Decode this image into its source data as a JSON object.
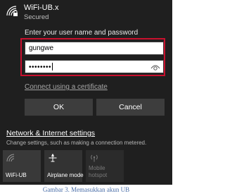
{
  "network": {
    "ssid": "WiFi-UB.x",
    "status": "Secured",
    "icon": "wifi-secured-icon"
  },
  "credentials": {
    "prompt": "Enter your user name and password",
    "username_value": "gungwe",
    "password_value": "••••••••",
    "reveal_icon": "eye-icon"
  },
  "links": {
    "certificate": "Connect using a certificate",
    "settings": "Network & Internet settings",
    "settings_desc": "Change settings, such as making a connection metered."
  },
  "buttons": {
    "ok": "OK",
    "cancel": "Cancel"
  },
  "quick_actions": [
    {
      "label": "WiFi-UB",
      "icon": "wifi-icon",
      "state": "on"
    },
    {
      "label": "Airplane mode",
      "icon": "airplane-icon",
      "state": "off"
    },
    {
      "label": "Mobile hotspot",
      "label_line1": "Mobile",
      "label_line2": "hotspot",
      "icon": "hotspot-icon",
      "state": "disabled"
    }
  ],
  "caption": "Gambar 3. Memasukkan akun UB",
  "colors": {
    "panel_bg": "#1f1f1f",
    "button_bg": "#3d3d3d",
    "highlight_border": "#c8102e",
    "caption_text": "#4a6ea8"
  }
}
